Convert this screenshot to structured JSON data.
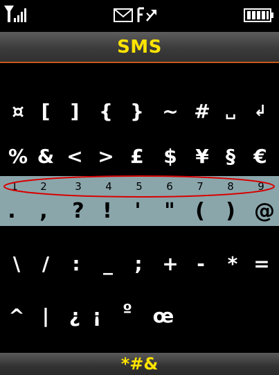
{
  "status_bar": {
    "signal_icon": "signal-bars-icon",
    "message_icon": "envelope-icon",
    "call_forward_icon": "call-forward-icon",
    "battery_icon": "battery-full-icon"
  },
  "header": {
    "title": "SMS"
  },
  "symbol_grid": {
    "rows": [
      [
        "¤",
        "[",
        "]",
        "{",
        "}",
        "~",
        "#",
        "␣",
        "↲"
      ],
      [
        "%",
        "&",
        "<",
        ">",
        "£",
        "$",
        "¥",
        "§",
        "€"
      ],
      [
        "1",
        "2",
        "3",
        "4",
        "5",
        "6",
        "7",
        "8",
        "9"
      ],
      [
        ".",
        ",",
        "?",
        "!",
        "'",
        "\"",
        "(",
        ")",
        "@"
      ],
      [
        "\\",
        "/",
        ":",
        "_",
        ";",
        "+",
        "-",
        "*",
        "="
      ],
      [
        "^",
        "|",
        "¿",
        "¡",
        "º",
        "œ",
        "",
        "",
        ""
      ]
    ]
  },
  "softkey": {
    "label": "*#&"
  },
  "colors": {
    "title": "#ffe400",
    "header_line": "#c85a1a",
    "selected_row": "#8aa6ab",
    "highlight_ellipse": "#d80000"
  }
}
